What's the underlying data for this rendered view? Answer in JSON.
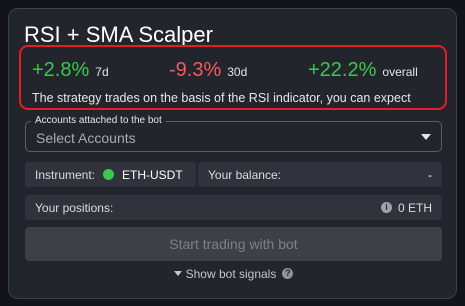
{
  "bot": {
    "title": "RSI + SMA Scalper",
    "stats": [
      {
        "value": "+2.8%",
        "period": "7d"
      },
      {
        "value": "-9.3%",
        "period": "30d"
      },
      {
        "value": "+22.2%",
        "period": "overall"
      }
    ],
    "description": "The strategy trades on the basis of the RSI indicator, you can expect"
  },
  "accounts": {
    "legend": "Accounts attached to the bot",
    "placeholder": "Select Accounts"
  },
  "instrument": {
    "label": "Instrument:",
    "symbol": "ETH-USDT"
  },
  "balance": {
    "label": "Your balance:",
    "value": "-"
  },
  "positions": {
    "label": "Your positions:",
    "value": "0 ETH"
  },
  "actions": {
    "start_label": "Start trading with bot",
    "signals_label": "Show bot signals"
  },
  "colors": {
    "positive": "#3cc84a",
    "negative": "#f25b5e",
    "highlight_border": "#e41e26"
  },
  "icons": {
    "instrument_status": "green-dot-icon",
    "positions_info": "info-icon",
    "signals_toggle": "caret-down-icon",
    "signals_help": "help-icon"
  }
}
